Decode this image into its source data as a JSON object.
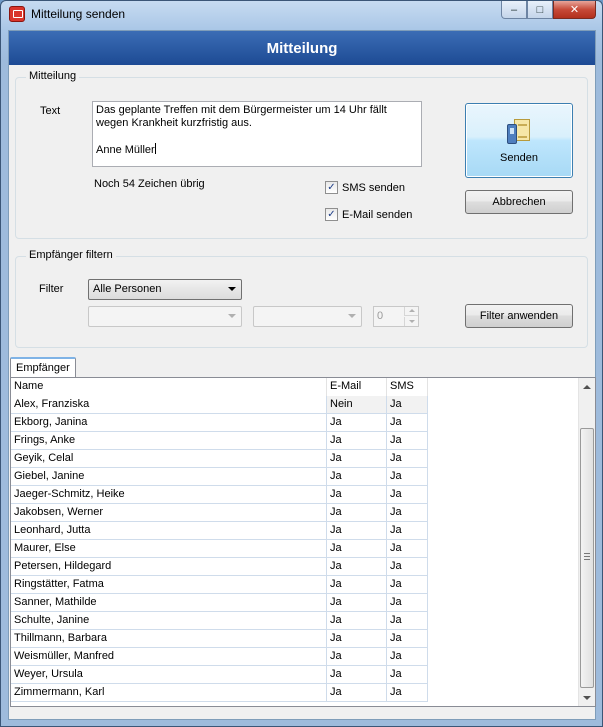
{
  "window": {
    "title": "Mitteilung senden",
    "minimize": "–",
    "maximize": "□",
    "close": "✕"
  },
  "header": {
    "title": "Mitteilung"
  },
  "message_group": {
    "label": "Mitteilung",
    "text_label": "Text",
    "text_value": "Das geplante Treffen mit dem Bürgermeister um 14 Uhr fällt wegen Krankheit kurzfristig aus.\n\nAnne Müller",
    "remaining": "Noch 54 Zeichen übrig",
    "sms_label": "SMS senden",
    "sms_checked": true,
    "email_label": "E-Mail senden",
    "email_checked": true,
    "send_label": "Senden",
    "cancel_label": "Abbrechen"
  },
  "filter_group": {
    "label": "Empfänger filtern",
    "filter_label": "Filter",
    "filter_value": "Alle Personen",
    "secondary_value": "",
    "tertiary_value": "",
    "number_value": "0",
    "apply_label": "Filter anwenden"
  },
  "recipients": {
    "tab_label": "Empfänger",
    "columns": [
      "Name",
      "E-Mail",
      "SMS"
    ],
    "rows": [
      [
        "Alex, Franziska",
        "Nein",
        "Ja"
      ],
      [
        "Ekborg, Janina",
        "Ja",
        "Ja"
      ],
      [
        "Frings, Anke",
        "Ja",
        "Ja"
      ],
      [
        "Geyik, Celal",
        "Ja",
        "Ja"
      ],
      [
        "Giebel, Janine",
        "Ja",
        "Ja"
      ],
      [
        "Jaeger-Schmitz, Heike",
        "Ja",
        "Ja"
      ],
      [
        "Jakobsen, Werner",
        "Ja",
        "Ja"
      ],
      [
        "Leonhard, Jutta",
        "Ja",
        "Ja"
      ],
      [
        "Maurer, Else",
        "Ja",
        "Ja"
      ],
      [
        "Petersen, Hildegard",
        "Ja",
        "Ja"
      ],
      [
        "Ringstätter, Fatma",
        "Ja",
        "Ja"
      ],
      [
        "Sanner, Mathilde",
        "Ja",
        "Ja"
      ],
      [
        "Schulte, Janine",
        "Ja",
        "Ja"
      ],
      [
        "Thillmann, Barbara",
        "Ja",
        "Ja"
      ],
      [
        "Weismüller, Manfred",
        "Ja",
        "Ja"
      ],
      [
        "Weyer, Ursula",
        "Ja",
        "Ja"
      ],
      [
        "Zimmermann, Karl",
        "Ja",
        "Ja"
      ]
    ]
  }
}
